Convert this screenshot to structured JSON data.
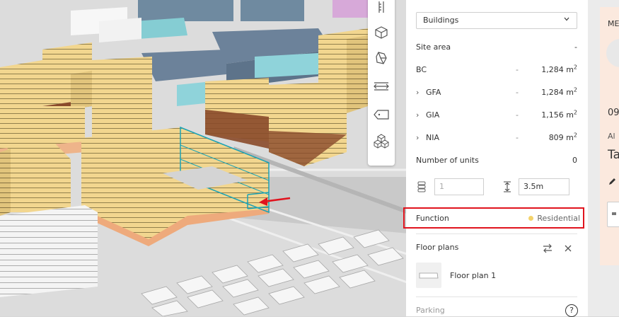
{
  "toolbar": {
    "tools": [
      "ruler-icon",
      "box-icon",
      "extrude-icon",
      "measure-icon",
      "tag-icon",
      "stack-icon"
    ]
  },
  "panel": {
    "type_select": "Buildings",
    "site_area": {
      "label": "Site area",
      "value": "-"
    },
    "bc": {
      "label": "BC",
      "dash": "-",
      "value": "1,284 m",
      "unit_sup": "2"
    },
    "gfa": {
      "label": "GFA",
      "dash": "-",
      "value": "1,284 m",
      "unit_sup": "2"
    },
    "gia": {
      "label": "GIA",
      "dash": "-",
      "value": "1,156 m",
      "unit_sup": "2"
    },
    "nia": {
      "label": "NIA",
      "dash": "-",
      "value": "809 m",
      "unit_sup": "2"
    },
    "units": {
      "label": "Number of units",
      "value": "0"
    },
    "floors_value": "1",
    "floor_height_value": "3.5m",
    "function": {
      "label": "Function",
      "value": "Residential",
      "dot_color": "#f3d36b"
    },
    "floor_plans": {
      "title": "Floor plans",
      "item": "Floor plan 1"
    },
    "parking": {
      "label": "Parking",
      "help": "?"
    }
  },
  "right_card": {
    "title": "ME",
    "text1": "09",
    "text2": "Al",
    "text3": "Ta"
  }
}
